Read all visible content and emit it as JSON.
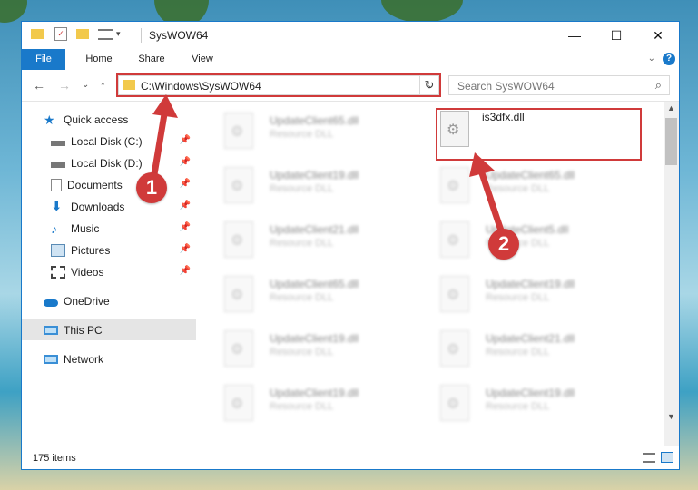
{
  "window": {
    "title": "SysWOW64",
    "controls": {
      "minimize": "—",
      "maximize": "☐",
      "close": "✕"
    }
  },
  "ribbon": {
    "tabs": [
      "File",
      "Home",
      "Share",
      "View"
    ]
  },
  "nav": {
    "address": "C:\\Windows\\SysWOW64",
    "search_placeholder": "Search SysWOW64"
  },
  "sidebar": {
    "items": [
      {
        "label": "Quick access",
        "icon": "star-icon"
      },
      {
        "label": "Local Disk (C:)",
        "icon": "drive-icon",
        "pinned": true
      },
      {
        "label": "Local Disk (D:)",
        "icon": "drive-icon",
        "pinned": true
      },
      {
        "label": "Documents",
        "icon": "documents-icon",
        "pinned": true
      },
      {
        "label": "Downloads",
        "icon": "download-icon",
        "pinned": true
      },
      {
        "label": "Music",
        "icon": "music-icon",
        "pinned": true
      },
      {
        "label": "Pictures",
        "icon": "pictures-icon",
        "pinned": true
      },
      {
        "label": "Videos",
        "icon": "videos-icon",
        "pinned": true
      },
      {
        "label": "OneDrive",
        "icon": "cloud-icon"
      },
      {
        "label": "This PC",
        "icon": "computer-icon",
        "selected": true
      },
      {
        "label": "Network",
        "icon": "network-icon"
      }
    ]
  },
  "files": {
    "left_column": [
      {
        "name": "UpdateClient65.dll",
        "type": "Resource DLL"
      },
      {
        "name": "UpdateClient19.dll",
        "type": "Resource DLL"
      },
      {
        "name": "UpdateClient21.dll",
        "type": "Resource DLL"
      },
      {
        "name": "UpdateClient65.dll",
        "type": "Resource DLL"
      },
      {
        "name": "UpdateClient19.dll",
        "type": "Resource DLL"
      },
      {
        "name": "UpdateClient19.dll",
        "type": "Resource DLL"
      }
    ],
    "right_column": [
      {
        "name": "is3dfx.dll",
        "type": ""
      },
      {
        "name": "UpdateClient65.dll",
        "type": "Resource DLL"
      },
      {
        "name": "UpdateClient5.dll",
        "type": "Resource DLL"
      },
      {
        "name": "UpdateClient19.dll",
        "type": "Resource DLL"
      },
      {
        "name": "UpdateClient21.dll",
        "type": "Resource DLL"
      },
      {
        "name": "UpdateClient19.dll",
        "type": "Resource DLL"
      }
    ]
  },
  "status": {
    "item_count": "175 items"
  },
  "annotations": {
    "step1": "1",
    "step2": "2",
    "color": "#d03a3a"
  }
}
